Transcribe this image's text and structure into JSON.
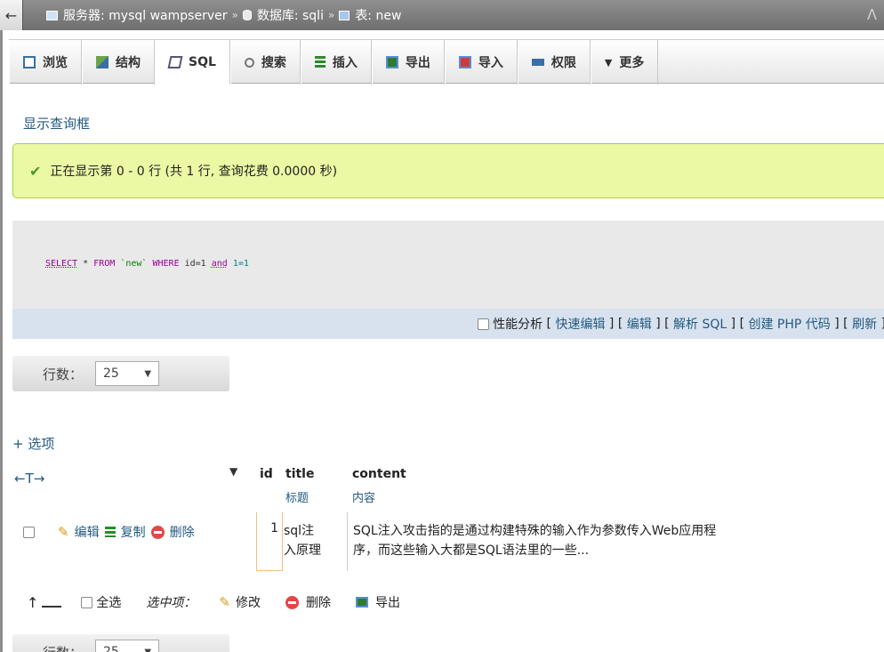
{
  "breadcrumb": {
    "back": "←",
    "server": "服务器: mysql wampserver",
    "database": "数据库: sqli",
    "table": "表: new",
    "sep": "»",
    "collapse": "ᐱ"
  },
  "tabs": [
    {
      "label": "浏览"
    },
    {
      "label": "结构"
    },
    {
      "label": "SQL"
    },
    {
      "label": "搜索"
    },
    {
      "label": "插入"
    },
    {
      "label": "导出"
    },
    {
      "label": "导入"
    },
    {
      "label": "权限"
    },
    {
      "label": "更多",
      "prefix": "▼"
    }
  ],
  "show_query_link": "显示查询框",
  "success_message": "正在显示第 0 - 0 行 (共 1 行, 查询花费 0.0000 秒)",
  "sql": {
    "select": "SELECT",
    "star": "*",
    "from": "FROM",
    "table": "`new`",
    "where": "WHERE",
    "cond1": "id=1",
    "and": "and",
    "cond2": "1=1"
  },
  "sql_actions": {
    "profiling": "性能分析",
    "quick_edit": "快速编辑",
    "edit": "编辑",
    "explain": "解析 SQL",
    "create_php": "创建 PHP 代码",
    "refresh": "刷新"
  },
  "rows_control": {
    "label": "行数：",
    "value": "25",
    "caret": "▼"
  },
  "options_link": "+ 选项",
  "columns_nav": "←T→",
  "sort_indicator": "▼",
  "columns": [
    {
      "name": "id",
      "comment": ""
    },
    {
      "name": "title",
      "comment": "标题"
    },
    {
      "name": "content",
      "comment": "内容"
    }
  ],
  "rows": [
    {
      "id": "1",
      "title_line1": "sql注",
      "title_line2": "入原理",
      "content_line1": "SQL注入攻击指的是通过构建特殊的输入作为参数传入Web应用程",
      "content_line2": "序，而这些输入大都是SQL语法里的一些...",
      "edit": "编辑",
      "copy": "复制",
      "delete": "删除"
    }
  ],
  "bulk": {
    "check_all": "全选",
    "with_selected": "选中项：",
    "modify": "修改",
    "delete": "删除",
    "export": "导出"
  },
  "colors": {
    "success_bg": "#ebf8a4",
    "link": "#235a81",
    "sql_keyword": "#990099"
  }
}
